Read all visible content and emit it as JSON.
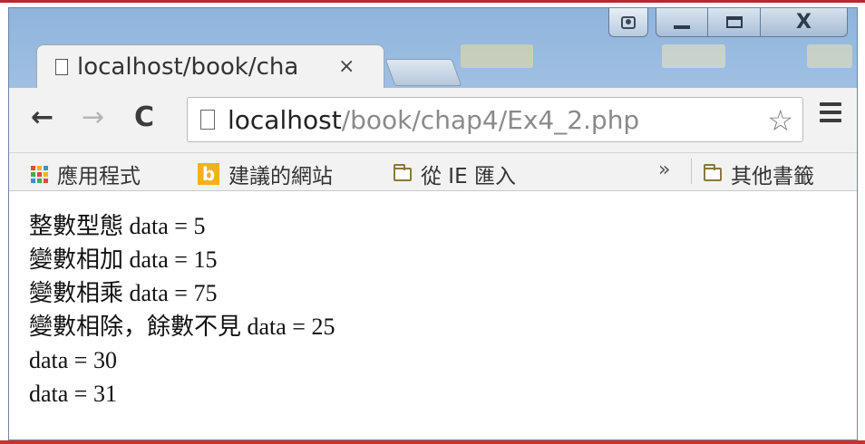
{
  "tab": {
    "title": "localhost/book/cha",
    "close_glyph": "×"
  },
  "caption_buttons": {
    "close_glyph": "X"
  },
  "toolbar": {
    "back_glyph": "←",
    "forward_glyph": "→",
    "reload_glyph": "C",
    "url_host": "localhost",
    "url_path": "/book/chap4/Ex4_2.php",
    "star_glyph": "☆"
  },
  "bookmarks": {
    "apps_label": "應用程式",
    "suggested_label": "建議的網站",
    "ie_import_label": "從 IE 匯入",
    "overflow_glyph": "»",
    "other_label": "其他書籤",
    "bing_glyph": "b"
  },
  "content": {
    "lines": [
      "整數型態 data = 5",
      "變數相加 data = 15",
      "變數相乘 data = 75",
      "變數相除，餘數不見 data = 25",
      "data = 30",
      "data = 31"
    ]
  },
  "colors": {
    "frame": "#a9c7e6",
    "toolbar": "#f2f2f2",
    "accent_rule": "#b8282e",
    "bing": "#f2b21c"
  },
  "icons": [
    "document-icon",
    "star-icon",
    "menu-icon",
    "apps-icon",
    "bing-icon",
    "folder-icon",
    "profile-icon"
  ]
}
